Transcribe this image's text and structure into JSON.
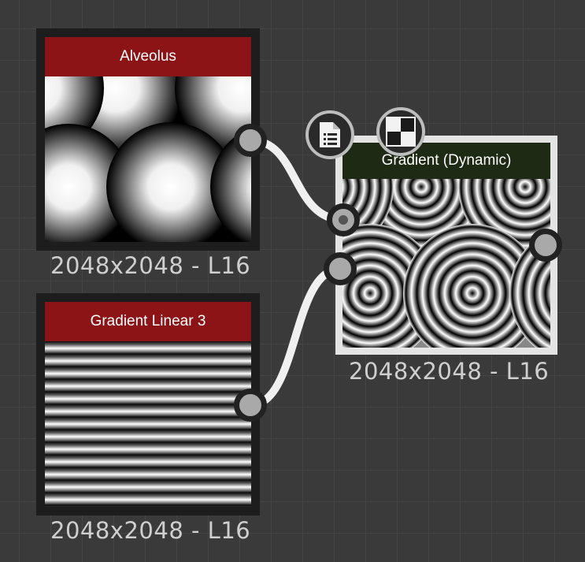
{
  "nodes": {
    "alveolus": {
      "title": "Alveolus",
      "caption": "2048x2048 - L16"
    },
    "gradient_linear": {
      "title": "Gradient Linear 3",
      "caption": "2048x2048 - L16"
    },
    "gradient_dynamic": {
      "title": "Gradient (Dynamic)",
      "caption": "2048x2048 - L16"
    }
  },
  "icons": {
    "node_document": "document-list-icon",
    "node_tiling": "checker-tiling-icon"
  },
  "colors": {
    "canvas_bg": "#3a3a3a",
    "header_red": "#8c1417",
    "header_green": "#1f2a14",
    "wire": "#f0f0f0",
    "port": "#a9a9a9"
  }
}
